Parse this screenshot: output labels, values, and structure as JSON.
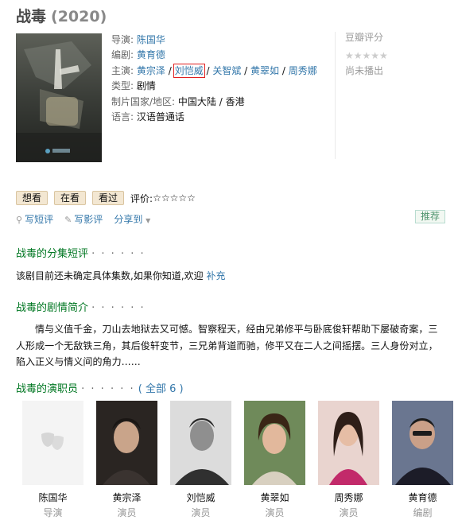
{
  "title": {
    "name": "战毒",
    "year": "(2020)"
  },
  "info": {
    "director_label": "导演:",
    "director": "陈国华",
    "writer_label": "编剧:",
    "writer": "黄育德",
    "cast_label": "主演:",
    "cast": [
      "黄宗泽",
      "刘恺威",
      "关智斌",
      "黄翠如",
      "周秀娜"
    ],
    "separator": "/",
    "genre_label": "类型:",
    "genre": "剧情",
    "region_label": "制片国家/地区:",
    "region": "中国大陆 / 香港",
    "language_label": "语言:",
    "language": "汉语普通话"
  },
  "rating": {
    "label": "豆瓣评分",
    "stars": "★★★★★",
    "status": "尚未播出"
  },
  "actions": {
    "want": "想看",
    "doing": "在看",
    "done": "看过",
    "my_rating_label": "评价:",
    "my_rating_stars": "☆☆☆☆☆"
  },
  "subactions": {
    "short_review": "写短评",
    "review": "写影评",
    "share": "分享到",
    "share_arrow": "▼",
    "recommend": "推荐"
  },
  "episodes": {
    "heading": "战毒的分集短评",
    "dots": "· · · · · ·",
    "text": "该剧目前还未确定具体集数,如果你知道,欢迎",
    "link": "补充"
  },
  "synopsis": {
    "heading": "战毒的剧情简介",
    "dots": "· · · · · ·",
    "text": "情与义值千金，刀山去地狱去又可憾。智察程天，经由兄弟修平与卧底俊轩帮助下屡破奇案，三人形成一个无敌铁三角，其后俊轩变节，三兄弟背道而驰，修平又在二人之间摇摆。三人身份对立，陷入正义与情义间的角力……"
  },
  "cast_section": {
    "heading": "战毒的演职员",
    "dots": "· · · · · ·",
    "all": "( 全部 6 )",
    "members": [
      {
        "name": "陈国华",
        "role": "导演"
      },
      {
        "name": "黄宗泽",
        "role": "演员"
      },
      {
        "name": "刘恺威",
        "role": "演员"
      },
      {
        "name": "黄翠如",
        "role": "演员"
      },
      {
        "name": "周秀娜",
        "role": "演员"
      },
      {
        "name": "黄育德",
        "role": "编剧"
      }
    ]
  },
  "colors": {
    "link": "#3377aa",
    "heading": "#007722",
    "highlight_box": "#e02020"
  }
}
